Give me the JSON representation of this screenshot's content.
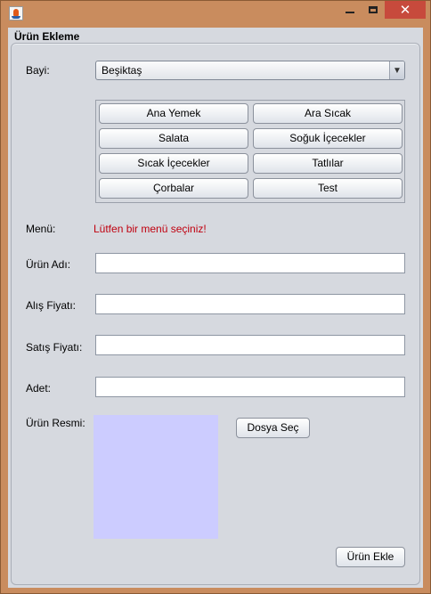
{
  "window": {
    "title": "",
    "controls": {
      "minimize": "",
      "maximize": "",
      "close": "✕"
    },
    "app_icon": "java-cup-icon"
  },
  "form": {
    "group_title": "Ürün Ekleme",
    "bayi": {
      "label": "Bayi:",
      "selected": "Beşiktaş",
      "arrow": "▼"
    },
    "categories": [
      "Ana Yemek",
      "Ara Sıcak",
      "Salata",
      "Soğuk İçecekler",
      "Sıcak İçecekler",
      "Tatlılar",
      "Çorbalar",
      "Test"
    ],
    "menu": {
      "label": "Menü:",
      "status": "Lütfen bir menü seçiniz!"
    },
    "urun_adi": {
      "label": "Ürün Adı:",
      "value": ""
    },
    "alis_fiyati": {
      "label": "Alış Fiyatı:",
      "value": ""
    },
    "satis_fiyati": {
      "label": "Satış Fiyatı:",
      "value": ""
    },
    "adet": {
      "label": "Adet:",
      "value": ""
    },
    "urun_resmi": {
      "label": "Ürün Resmi:",
      "choose_button": "Dosya Seç"
    },
    "submit_button": "Ürün Ekle"
  },
  "colors": {
    "frame": "#c98c5e",
    "panel": "#d6d9df",
    "error_text": "#c0000f",
    "image_placeholder": "#ccccff",
    "close_button": "#c74a3c"
  }
}
